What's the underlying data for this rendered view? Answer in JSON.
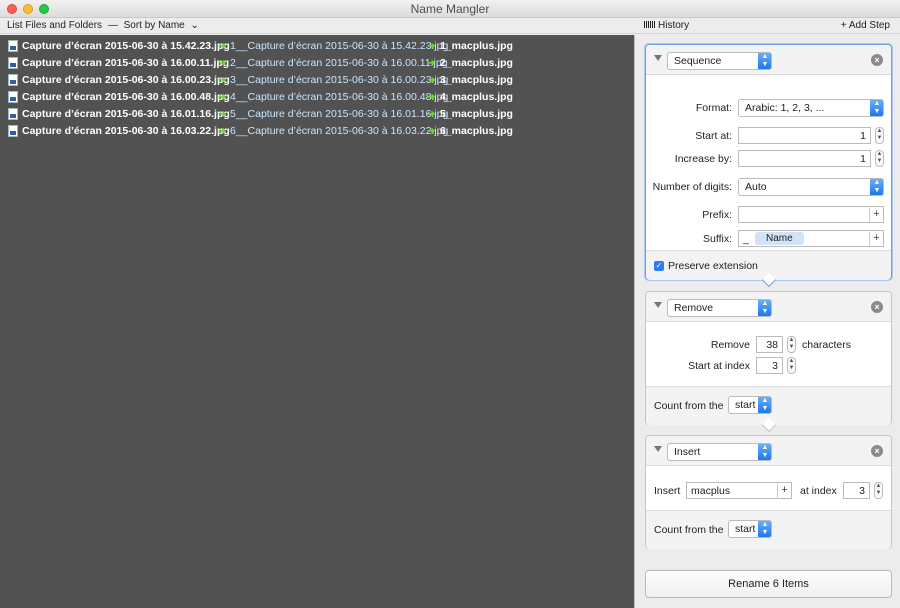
{
  "window": {
    "title": "Name Mangler"
  },
  "toolbar": {
    "list_label": "List Files and Folders",
    "separator": "—",
    "sort_label": "Sort by Name",
    "sort_chevron": "⌄",
    "history_label": "History",
    "add_step_label": "+ Add Step"
  },
  "files": [
    {
      "original": "Capture d’écran 2015-06-30 à 15.42.23.jpg",
      "intermediate": "1__Capture d’écran 2015-06-30 à 15.42.23.jpg",
      "result": "1_macplus.jpg"
    },
    {
      "original": "Capture d’écran 2015-06-30 à 16.00.11.jpg",
      "intermediate": "2__Capture d’écran 2015-06-30 à 16.00.11.jpg",
      "result": "2_macplus.jpg"
    },
    {
      "original": "Capture d’écran 2015-06-30 à 16.00.23.jpg",
      "intermediate": "3__Capture d’écran 2015-06-30 à 16.00.23.jpg",
      "result": "3_macplus.jpg"
    },
    {
      "original": "Capture d’écran 2015-06-30 à 16.00.48.jpg",
      "intermediate": "4__Capture d’écran 2015-06-30 à 16.00.48.jpg",
      "result": "4_macplus.jpg"
    },
    {
      "original": "Capture d’écran 2015-06-30 à 16.01.16.jpg",
      "intermediate": "5__Capture d’écran 2015-06-30 à 16.01.16.jpg",
      "result": "5_macplus.jpg"
    },
    {
      "original": "Capture d’écran 2015-06-30 à 16.03.22.jpg",
      "intermediate": "6__Capture d’écran 2015-06-30 à 16.03.22.jpg",
      "result": "6_macplus.jpg"
    }
  ],
  "arrow_glyph": "➜",
  "steps": {
    "sequence": {
      "type": "Sequence",
      "format_label": "Format:",
      "format_value": "Arabic: 1, 2, 3, ...",
      "start_label": "Start at:",
      "start_value": "1",
      "increase_label": "Increase by:",
      "increase_value": "1",
      "digits_label": "Number of digits:",
      "digits_value": "Auto",
      "prefix_label": "Prefix:",
      "prefix_value": "",
      "suffix_label": "Suffix:",
      "suffix_literal": "_",
      "suffix_token": "Name",
      "preserve_label": "Preserve extension",
      "preserve_checked": true
    },
    "remove": {
      "type": "Remove",
      "remove_label": "Remove",
      "remove_value": "38",
      "characters_label": "characters",
      "index_label": "Start at index",
      "index_value": "3",
      "count_label": "Count from the",
      "count_value": "start"
    },
    "insert": {
      "type": "Insert",
      "insert_label": "Insert",
      "insert_value": "macplus",
      "at_label": "at index",
      "at_value": "3",
      "count_label": "Count from the",
      "count_value": "start"
    }
  },
  "rename_button": "Rename 6 Items",
  "colors": {
    "list_background": "#525252",
    "accent": "#2d7cf0",
    "arrow": "#6fd22f"
  }
}
